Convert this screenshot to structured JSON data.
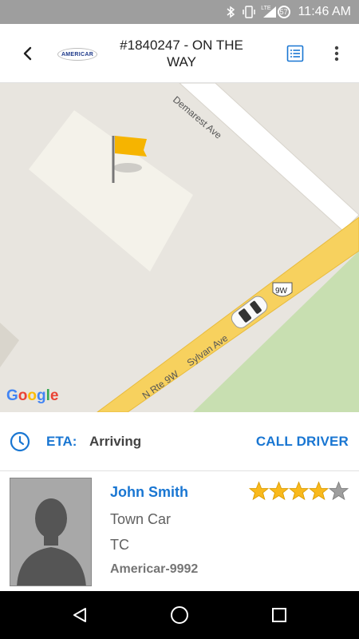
{
  "status_bar": {
    "time": "11:46 AM",
    "battery_level": "57",
    "network": "LTE"
  },
  "header": {
    "title": "#1840247 - ON THE WAY",
    "logo_text": "AMERICAR"
  },
  "map": {
    "streets": [
      "Demarest Ave",
      "Sylvan Ave",
      "N Rte 9W"
    ],
    "route_shield": "9W",
    "attribution": "Google"
  },
  "eta": {
    "label": "ETA:",
    "value": "Arriving",
    "call_label": "CALL DRIVER"
  },
  "driver": {
    "name": "John Smith",
    "vehicle_type": "Town Car",
    "vehicle_code": "TC",
    "vehicle_id": "Americar-9992",
    "rating": 4,
    "rating_max": 5
  },
  "colors": {
    "accent": "#1976d2",
    "star": "#f9b91c",
    "star_empty": "#9e9e9e",
    "road": "#f7d15e",
    "park": "#c8dfb1"
  },
  "icons": {
    "status": [
      "bluetooth-icon",
      "vibrate-icon",
      "signal-icon",
      "battery-icon"
    ],
    "header": [
      "back-arrow-icon",
      "list-icon",
      "more-vertical-icon"
    ],
    "nav": [
      "nav-back-icon",
      "nav-home-icon",
      "nav-recents-icon"
    ]
  }
}
